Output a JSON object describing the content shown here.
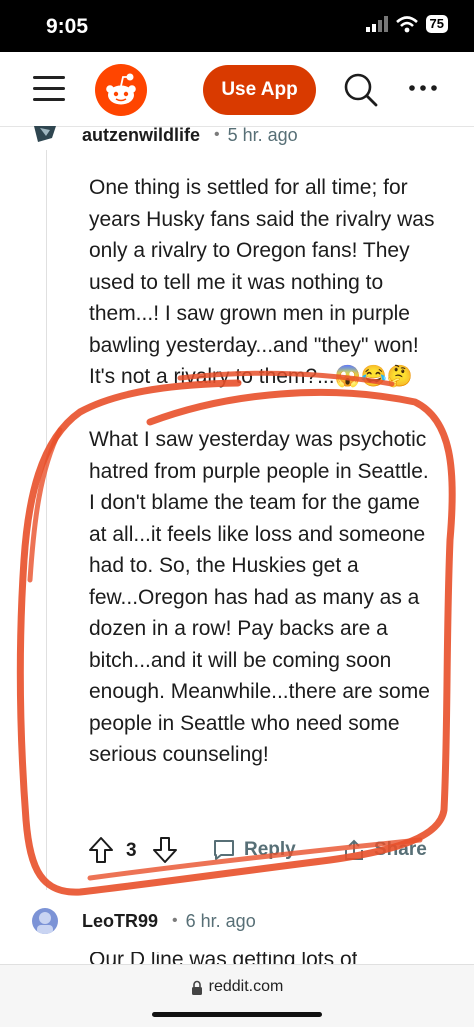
{
  "status_bar": {
    "time": "9:05",
    "battery": "75"
  },
  "header": {
    "use_app_label": "Use App"
  },
  "comment": {
    "author": "autzenwildlife",
    "separator": "•",
    "time_ago": "5 hr. ago",
    "body": "One thing is settled for all time; for years Husky fans said the rivalry was only a rivalry to Oregon fans! They used to tell me it was nothing to them...! I saw grown men in purple bawling yesterday...and \"they\" won! It's not a rivalry to them?...😱😂🤔\n\nWhat I saw yesterday was psychotic hatred from purple people in Seattle. I don't blame the team for the game at all...it feels like loss and someone had to. So, the Huskies get a few...Oregon has had as many as a dozen in a row! Pay backs are a bitch...and it will be coming soon enough. Meanwhile...there are some people in Seattle who need some serious counseling!",
    "vote_count": "3",
    "reply_label": "Reply",
    "share_label": "Share"
  },
  "next_comment": {
    "author": "LeoTR99",
    "separator": "•",
    "time_ago": "6 hr. ago",
    "preview": "Our D line was getting lots of"
  },
  "bottom_bar": {
    "url": "reddit.com"
  },
  "colors": {
    "brand": "#ff4500",
    "use_app_bg": "#d93a00",
    "annotation": "#e8502a"
  }
}
